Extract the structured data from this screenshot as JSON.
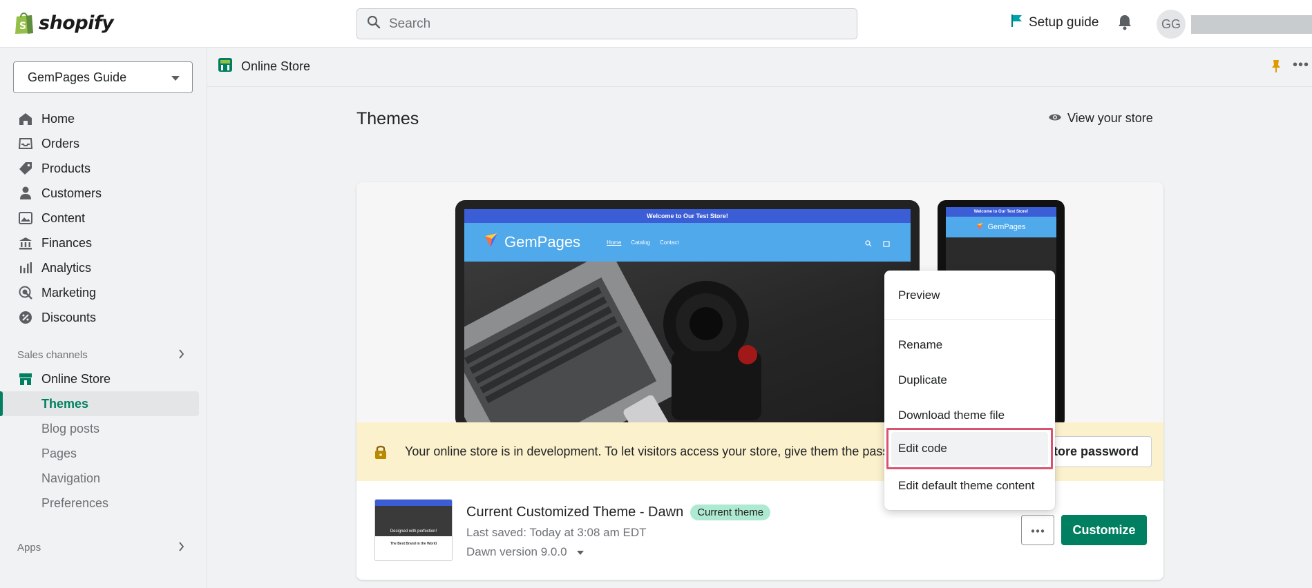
{
  "brand": {
    "logo_text": "shopify"
  },
  "topbar": {
    "search_placeholder": "Search",
    "setup_guide": "Setup guide",
    "avatar_initials": "GG"
  },
  "sidebar": {
    "store_name": "GemPages Guide",
    "nav": [
      "Home",
      "Orders",
      "Products",
      "Customers",
      "Content",
      "Finances",
      "Analytics",
      "Marketing",
      "Discounts"
    ],
    "sales_channels_label": "Sales channels",
    "online_store": "Online Store",
    "online_store_sub": [
      "Themes",
      "Blog posts",
      "Pages",
      "Navigation",
      "Preferences"
    ],
    "apps_label": "Apps"
  },
  "page_header": {
    "title": "Online Store"
  },
  "page": {
    "title": "Themes",
    "view_store": "View your store"
  },
  "preview": {
    "announcement": "Welcome to Our Test Store!",
    "brand": "GemPages",
    "links": [
      "Home",
      "Catalog",
      "Contact"
    ]
  },
  "banner": {
    "text": "Your online store is in development. To let visitors access your store, give them the passwo",
    "button": "store password"
  },
  "theme": {
    "name": "Current Customized Theme - Dawn",
    "badge": "Current theme",
    "last_saved": "Last saved: Today at 3:08 am EDT",
    "version": "Dawn version 9.0.0",
    "customize": "Customize",
    "thumb_hero": "Designed with perfection!",
    "thumb_text": "The Best Brand in the World"
  },
  "menu": {
    "items": [
      "Preview",
      "Rename",
      "Duplicate",
      "Download theme file",
      "Edit code",
      "Edit default theme content"
    ],
    "highlighted": "Edit code"
  },
  "colors": {
    "accent": "#008060",
    "highlight_border": "#d9526f",
    "banner": "#fcf1cd",
    "badge": "#aee9d1"
  }
}
